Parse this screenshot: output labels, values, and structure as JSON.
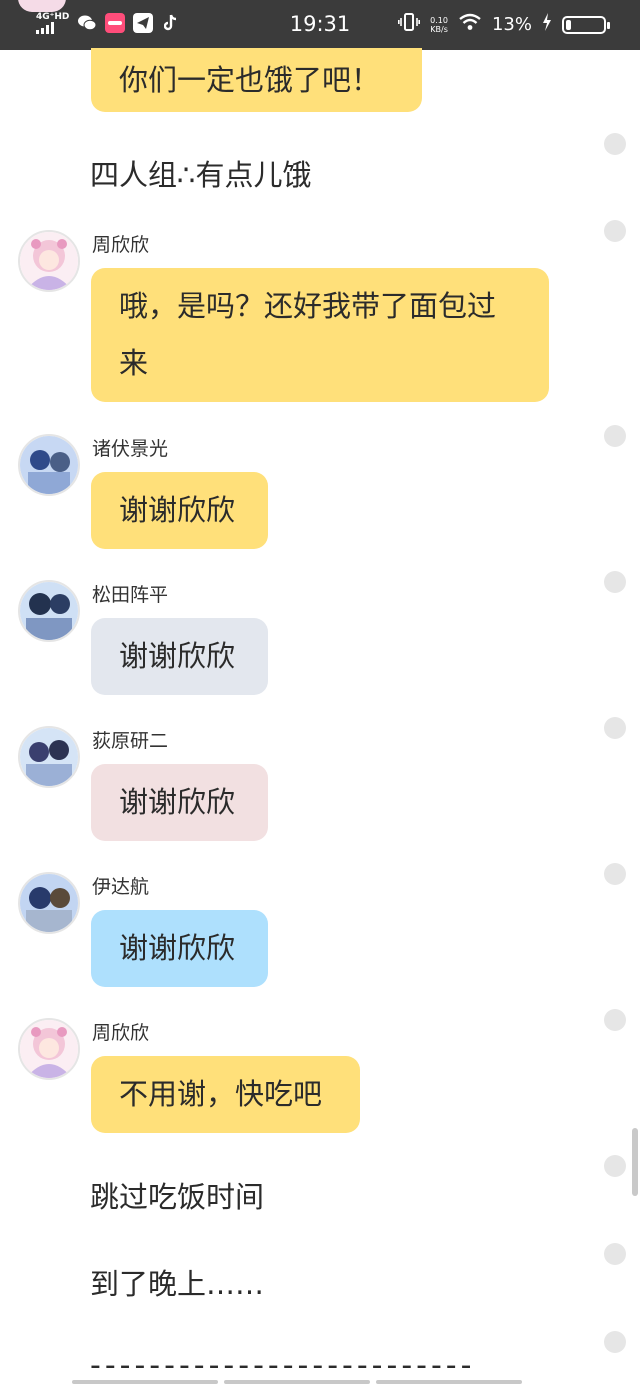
{
  "statusbar": {
    "network": "4G⁺HD",
    "time": "19:31",
    "speed_value": "0.10",
    "speed_unit": "KB/s",
    "battery": "13%",
    "battery_level": 0.13,
    "app_icons": [
      "wechat-icon",
      "app-icon",
      "telegram-icon",
      "tiktok-icon"
    ]
  },
  "messages": [
    {
      "kind": "bubble-only",
      "text": "你们一定也饿了吧！",
      "color": "#ffe07a"
    },
    {
      "kind": "narration",
      "text": "四人组∴有点儿饿"
    },
    {
      "kind": "message",
      "name": "周欣欣",
      "text": "哦，是吗？还好我带了面包过\n来",
      "color": "#ffe07a"
    },
    {
      "kind": "message",
      "name": "诸伏景光",
      "text": "谢谢欣欣",
      "color": "#ffe07a"
    },
    {
      "kind": "message",
      "name": "松田阵平",
      "text": "谢谢欣欣",
      "color": "#e3e7ee"
    },
    {
      "kind": "message",
      "name": "荻原研二",
      "text": "谢谢欣欣",
      "color": "#f2e0e1"
    },
    {
      "kind": "message",
      "name": "伊达航",
      "text": "谢谢欣欣",
      "color": "#aee0fd"
    },
    {
      "kind": "message",
      "name": "周欣欣",
      "text": "不用谢，快吃吧",
      "color": "#ffe07a"
    },
    {
      "kind": "narration",
      "text": "跳过吃饭时间"
    },
    {
      "kind": "narration",
      "text": "到了晚上……"
    }
  ],
  "divider": "--------------------------"
}
